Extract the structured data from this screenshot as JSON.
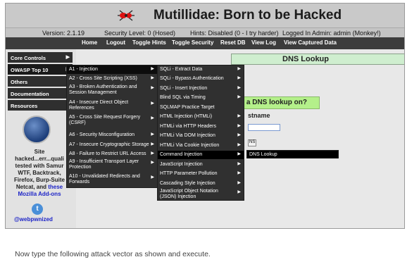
{
  "header": {
    "title": "Mutillidae: Born to be Hacked",
    "logo": "mutillidae-ant-logo"
  },
  "status": {
    "version": "Version: 2.1.19",
    "security_level": "Security Level: 0 (Hosed)",
    "hints": "Hints: Disabled (0 - I try harder)",
    "logged_in": "Logged In Admin: admin (Monkey!)"
  },
  "nav": [
    "Home",
    "Logout",
    "Toggle Hints",
    "Toggle Security",
    "Reset DB",
    "View Log",
    "View Captured Data"
  ],
  "left_nav": [
    "Core Controls",
    "OWASP Top 10",
    "Others",
    "Documentation",
    "Resources"
  ],
  "promo": {
    "lines": [
      "Site",
      "hacked...err...quali",
      "tested with Samur",
      "WTF, Backtrack,",
      "Firefox, Burp-Suite",
      "Netcat, and"
    ],
    "link_text": "these",
    "addons": "Mozilla Add-ons",
    "twitter_handle": "@webpwnized"
  },
  "main": {
    "page_title": "DNS Lookup",
    "prompt": "o a DNS lookup on?",
    "host_label": "stname",
    "button_label": "NS"
  },
  "menu1": [
    "A1 - Injection",
    "A2 - Cross Site Scripting (XSS)",
    "A3 - Broken Authentication and Session Management",
    "A4 - Insecure Direct Object References",
    "A5 - Cross Site Request Forgery (CSRF)",
    "A6 - Security Misconfiguration",
    "A7 - Insecure Cryptographic Storage",
    "A8 - Failure to Restrict URL Access",
    "A9 - Insufficient Transport Layer Protection",
    "A10 - Unvalidated Redirects and Forwards"
  ],
  "menu2": [
    "SQLi - Extract Data",
    "SQLi - Bypass Authentication",
    "SQLi - Insert Injection",
    "Blind SQL via Timing",
    "SQLMAP Practice Target",
    "HTML Injection (HTMLi)",
    "HTMLi via HTTP Headers",
    "HTMLi Via DOM Injection",
    "HTMLi Via Cookie Injection",
    "Command Injection",
    "JavaScript Injection",
    "HTTP Parameter Pollution",
    "Cascading Style Injection",
    "JavaScript Object Notation (JSON) Injection"
  ],
  "menu3": [
    "DNS Lookup"
  ],
  "caption": "Now type the following attack vector as shown and execute."
}
